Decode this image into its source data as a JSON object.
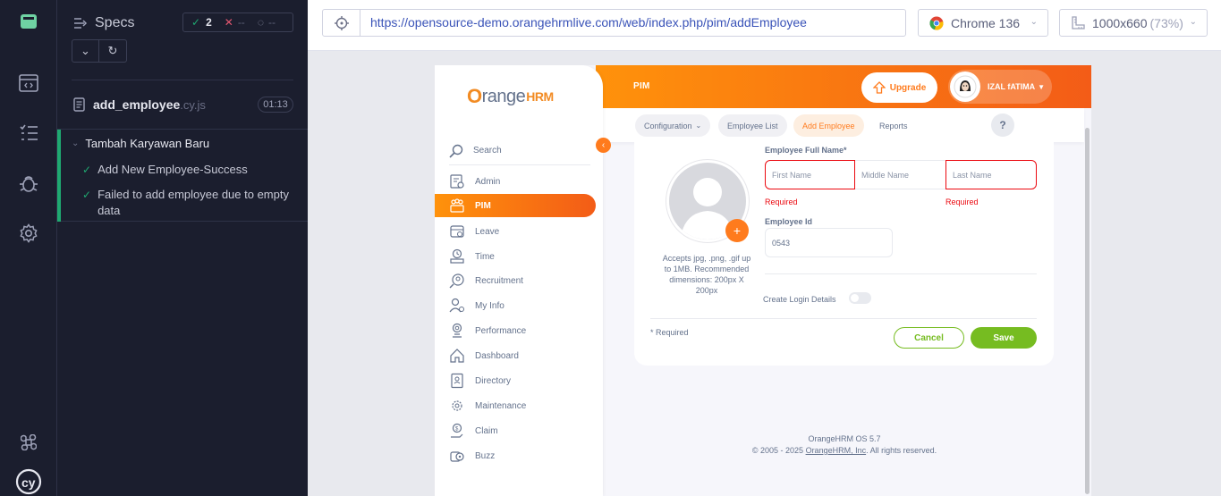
{
  "runner": {
    "specs_title": "Specs",
    "stats": {
      "passed": "2",
      "failed": "--",
      "pending": "--"
    },
    "file": {
      "name": "add_employee",
      "ext": ".cy.js",
      "duration": "01:13"
    },
    "suite": {
      "title": "Tambah Karyawan Baru",
      "tests": [
        "Add New Employee-Success",
        "Failed to add employee due to empty data"
      ]
    },
    "url": "https://opensource-demo.orangehrmlive.com/web/index.php/pim/addEmployee",
    "browser": "Chrome 136",
    "viewport": "1000x660",
    "viewport_scale": "(73%)",
    "colors": {
      "pass": "#1fa971",
      "fail": "#e45770",
      "accent": "#3a53b8"
    }
  },
  "app": {
    "logo": {
      "o": "O",
      "range": "range",
      "hrm": "HRM"
    },
    "search_label": "Search",
    "menu": [
      "Admin",
      "PIM",
      "Leave",
      "Time",
      "Recruitment",
      "My Info",
      "Performance",
      "Dashboard",
      "Directory",
      "Maintenance",
      "Claim",
      "Buzz"
    ],
    "header_title": "PIM",
    "upgrade_label": "Upgrade",
    "user_name": "IZAL fATIMA",
    "nav": [
      "Configuration",
      "Employee List",
      "Add Employee",
      "Reports"
    ],
    "help": "?",
    "form": {
      "full_name_label": "Employee Full Name*",
      "first_name_placeholder": "First Name",
      "middle_name_placeholder": "Middle Name",
      "last_name_placeholder": "Last Name",
      "required_error": "Required",
      "employee_id_label": "Employee Id",
      "employee_id_value": "0543",
      "photo_hint": "Accepts jpg, .png, .gif up to 1MB. Recommended dimensions: 200px X 200px",
      "create_login_label": "Create Login Details",
      "required_note": "* Required",
      "cancel": "Cancel",
      "save": "Save"
    },
    "footer": {
      "version": "OrangeHRM OS 5.7",
      "copyright_prefix": "© 2005 - 2025 ",
      "company": "OrangeHRM, Inc",
      "copyright_suffix": ". All rights reserved."
    },
    "colors": {
      "orange": "#ff7b1d",
      "green": "#76bc21",
      "error": "#eb0910"
    }
  }
}
